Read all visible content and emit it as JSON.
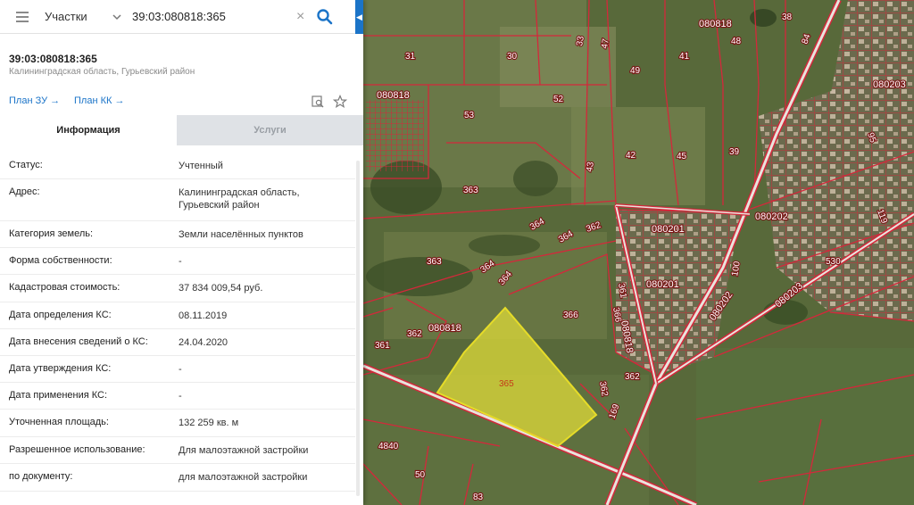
{
  "search": {
    "category": "Участки",
    "query": "39:03:080818:365"
  },
  "object": {
    "cadastral_number": "39:03:080818:365",
    "address_short": "Калининградская область, Гурьевский район"
  },
  "links": {
    "plan_zu": "План ЗУ →",
    "plan_kk": "План КК →"
  },
  "tabs": {
    "info": "Информация",
    "services": "Услуги"
  },
  "info_rows": [
    {
      "key": "Статус:",
      "value": "Учтенный"
    },
    {
      "key": "Адрес:",
      "value": "Калининградская область, Гурьевский район"
    },
    {
      "key": "Категория земель:",
      "value": "Земли населённых пунктов"
    },
    {
      "key": "Форма собственности:",
      "value": "-"
    },
    {
      "key": "Кадастровая стоимость:",
      "value": "37 834 009,54 руб."
    },
    {
      "key": "Дата определения КС:",
      "value": "08.11.2019"
    },
    {
      "key": "Дата внесения сведений о КС:",
      "value": "24.04.2020"
    },
    {
      "key": "Дата утверждения КС:",
      "value": "-"
    },
    {
      "key": "Дата применения КС:",
      "value": "-"
    },
    {
      "key": "Уточненная площадь:",
      "value": "132 259 кв. м"
    },
    {
      "key": "Разрешенное использование:",
      "value": "Для малоэтажной застройки"
    },
    {
      "key": "по документу:",
      "value": "для малоэтажной застройки"
    }
  ],
  "map_labels": {
    "l31": "31",
    "l30": "30",
    "l33": "33",
    "l47": "47",
    "l49": "49",
    "l41": "41",
    "l48": "48",
    "l38": "38",
    "l52": "52",
    "l53": "53",
    "l43": "43",
    "l42": "42",
    "l45": "45",
    "l39": "39",
    "l363a": "363",
    "l364a": "364",
    "l364b": "364",
    "l362a": "362",
    "l363b": "363",
    "l364c": "364",
    "l364d": "364",
    "l366": "366",
    "l361a": "361",
    "l366b": "366",
    "l362b": "362",
    "l361b": "361",
    "l365": "365",
    "l362c": "362",
    "l362d": "362",
    "l169": "169",
    "l4840": "4840",
    "l50": "50",
    "l83": "83",
    "l100": "100",
    "l119": "119",
    "l530": "530",
    "l95": "95",
    "l84": "84",
    "q080818a": "080818",
    "q080818b": "080818",
    "q080818c": "080818",
    "q080818d": "080818",
    "q080201a": "080201",
    "q080201b": "080201",
    "q080202a": "080202",
    "q080202b": "080202",
    "q080203a": "080203",
    "q080203b": "080203"
  },
  "colors": {
    "accent": "#1b74c8",
    "parcel_border": "#d4283b",
    "selected_parcel": "#d7d43a"
  },
  "icons": {
    "menu": "hamburger-icon",
    "dropdown": "chevron-down-icon",
    "clear": "close-icon",
    "search": "search-icon",
    "collapse": "chevron-left-icon",
    "map_search": "map-search-icon",
    "favorite": "star-icon"
  }
}
